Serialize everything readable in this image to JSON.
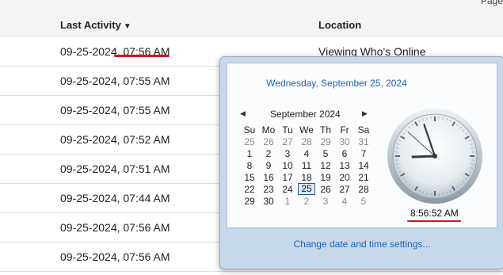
{
  "pagination_fragment": "Page",
  "table": {
    "headers": {
      "last_activity": "Last Activity",
      "location": "Location"
    },
    "rows": [
      {
        "last_activity": "09-25-2024, 07:56 AM",
        "location": "Viewing Who's Online"
      },
      {
        "last_activity": "09-25-2024, 07:55 AM",
        "location": ""
      },
      {
        "last_activity": "09-25-2024, 07:55 AM",
        "location": ""
      },
      {
        "last_activity": "09-25-2024, 07:52 AM",
        "location": ""
      },
      {
        "last_activity": "09-25-2024, 07:51 AM",
        "location": ""
      },
      {
        "last_activity": "09-25-2024, 07:44 AM",
        "location": ""
      },
      {
        "last_activity": "09-25-2024, 07:56 AM",
        "location": ""
      },
      {
        "last_activity": "09-25-2024, 07:56 AM",
        "location": ""
      }
    ]
  },
  "calendar": {
    "full_date": "Wednesday, September 25, 2024",
    "month_label": "September 2024",
    "weekdays": [
      "Su",
      "Mo",
      "Tu",
      "We",
      "Th",
      "Fr",
      "Sa"
    ],
    "days": [
      [
        "25",
        "26",
        "27",
        "28",
        "29",
        "30",
        "31"
      ],
      [
        "1",
        "2",
        "3",
        "4",
        "5",
        "6",
        "7"
      ],
      [
        "8",
        "9",
        "10",
        "11",
        "12",
        "13",
        "14"
      ],
      [
        "15",
        "16",
        "17",
        "18",
        "19",
        "20",
        "21"
      ],
      [
        "22",
        "23",
        "24",
        "25",
        "26",
        "27",
        "28"
      ],
      [
        "29",
        "30",
        "1",
        "2",
        "3",
        "4",
        "5"
      ]
    ],
    "today": "25",
    "time": "8:56:52 AM",
    "clock": {
      "hours": 8,
      "minutes": 56,
      "seconds": 52
    },
    "change_link": "Change date and time settings...",
    "accent": "#1f63b0",
    "annotation_color": "#d01818"
  }
}
